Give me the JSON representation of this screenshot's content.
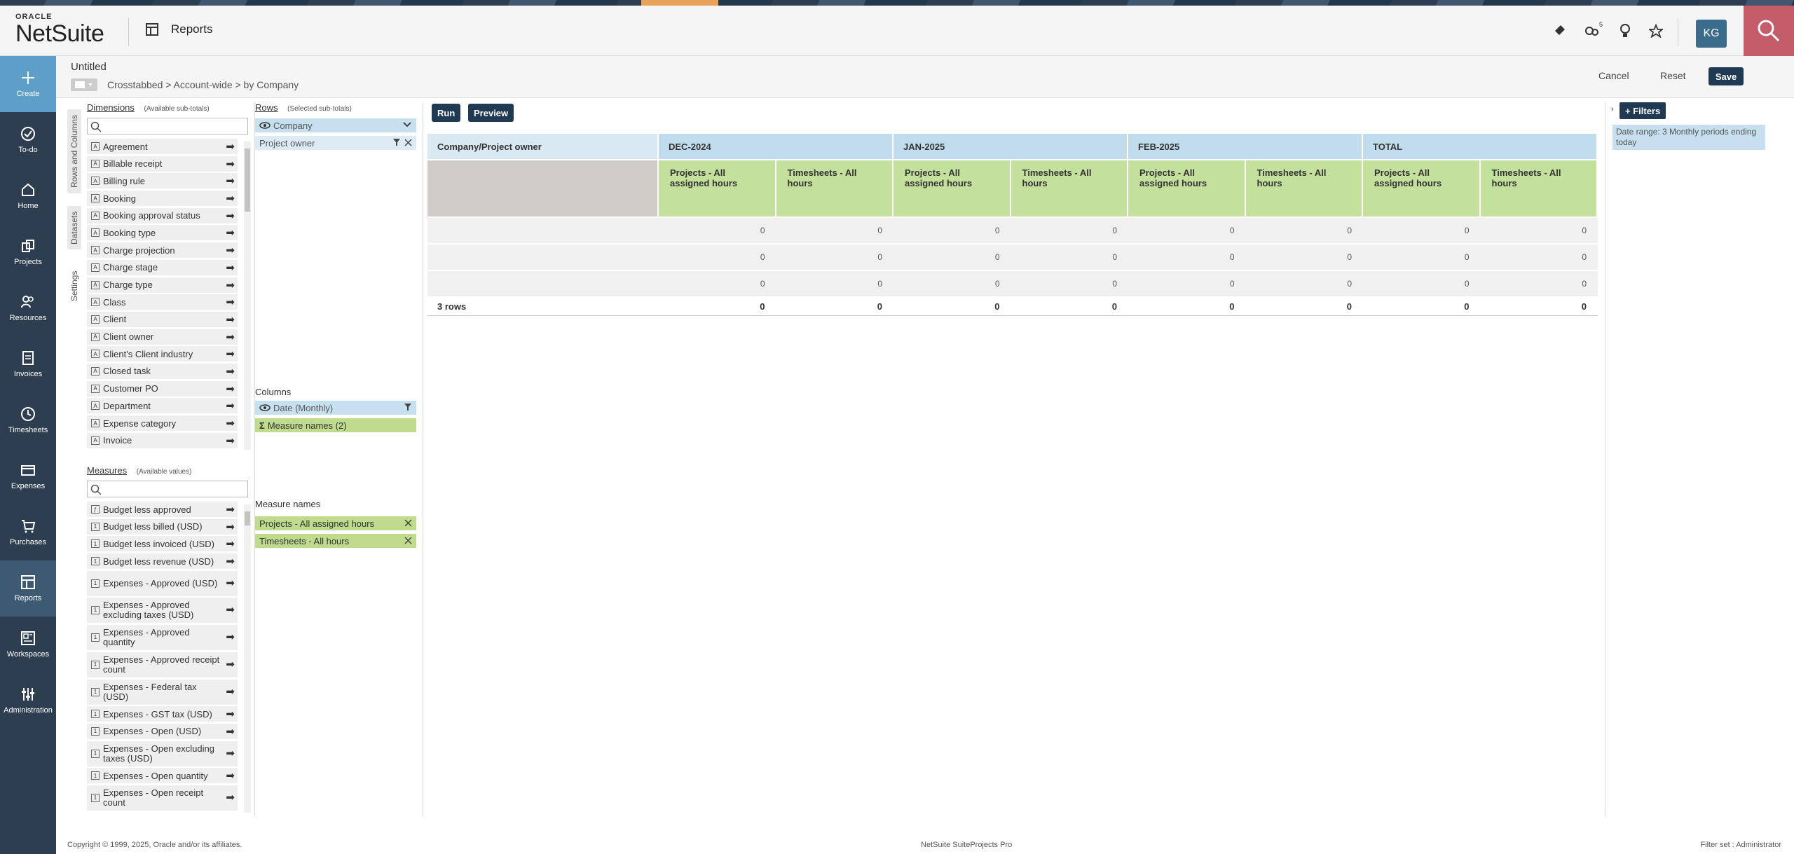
{
  "header": {
    "logo_top": "ORACLE",
    "logo_main": "NetSuite",
    "section_title": "Reports",
    "avatar_initials": "KG",
    "notification_count": "5",
    "search_color": "#c45c6a"
  },
  "nav": {
    "items": [
      {
        "label": "Create",
        "icon": "plus-icon"
      },
      {
        "label": "To-do",
        "icon": "check-circle-icon"
      },
      {
        "label": "Home",
        "icon": "home-icon"
      },
      {
        "label": "Projects",
        "icon": "projects-icon"
      },
      {
        "label": "Resources",
        "icon": "people-icon"
      },
      {
        "label": "Invoices",
        "icon": "invoice-icon"
      },
      {
        "label": "Timesheets",
        "icon": "clock-icon"
      },
      {
        "label": "Expenses",
        "icon": "card-icon"
      },
      {
        "label": "Purchases",
        "icon": "cart-icon"
      },
      {
        "label": "Reports",
        "icon": "reports-icon"
      },
      {
        "label": "Workspaces",
        "icon": "workspaces-icon"
      },
      {
        "label": "Administration",
        "icon": "sliders-icon"
      }
    ]
  },
  "subheader": {
    "title": "Untitled",
    "breadcrumb": "Crosstabbed > Account-wide > by Company",
    "cancel": "Cancel",
    "reset": "Reset",
    "save": "Save"
  },
  "tabs": {
    "rows_columns": "Rows and Columns",
    "datasets": "Datasets",
    "settings": "Settings"
  },
  "dimensions": {
    "title": "Dimensions",
    "subtitle": "(Available sub-totals)",
    "items": [
      "Agreement",
      "Billable receipt",
      "Billing rule",
      "Booking",
      "Booking approval status",
      "Booking type",
      "Charge projection",
      "Charge stage",
      "Charge type",
      "Class",
      "Client",
      "Client owner",
      "Client's Client industry",
      "Closed task",
      "Customer PO",
      "Department",
      "Expense category",
      "Invoice"
    ]
  },
  "measures": {
    "title": "Measures",
    "subtitle": "(Available values)",
    "items": [
      {
        "label": "Budget less approved",
        "tall": false
      },
      {
        "label": "Budget less billed (USD)",
        "tall": false
      },
      {
        "label": "Budget less invoiced (USD)",
        "tall": false
      },
      {
        "label": "Budget less revenue (USD)",
        "tall": false
      },
      {
        "label": "Expenses - Approved (USD)",
        "tall": true
      },
      {
        "label": "Expenses - Approved excluding taxes (USD)",
        "tall": true
      },
      {
        "label": "Expenses - Approved quantity",
        "tall": true
      },
      {
        "label": "Expenses - Approved receipt count",
        "tall": true
      },
      {
        "label": "Expenses - Federal tax (USD)",
        "tall": true
      },
      {
        "label": "Expenses - GST tax (USD)",
        "tall": false
      },
      {
        "label": "Expenses - Open (USD)",
        "tall": false
      },
      {
        "label": "Expenses - Open excluding taxes (USD)",
        "tall": true
      },
      {
        "label": "Expenses - Open quantity",
        "tall": false
      },
      {
        "label": "Expenses - Open receipt count",
        "tall": true
      }
    ]
  },
  "rows_panel": {
    "title": "Rows",
    "subtitle": "(Selected sub-totals)",
    "chips": [
      "Company",
      "Project owner"
    ]
  },
  "columns_panel": {
    "title": "Columns",
    "chips": [
      "Date (Monthly)",
      "Measure names (2)"
    ]
  },
  "measure_names_panel": {
    "title": "Measure names",
    "chips": [
      "Projects - All assigned hours",
      "Timesheets - All hours"
    ]
  },
  "report": {
    "run": "Run",
    "preview": "Preview",
    "row_header": "Company/Project owner",
    "periods": [
      "DEC-2024",
      "JAN-2025",
      "FEB-2025",
      "TOTAL"
    ],
    "measure_headers": [
      "Projects - All assigned hours",
      "Timesheets - All hours"
    ],
    "rows": [
      [
        "",
        "0",
        "0",
        "0",
        "0",
        "0",
        "0",
        "0",
        "0"
      ],
      [
        "",
        "0",
        "0",
        "0",
        "0",
        "0",
        "0",
        "0",
        "0"
      ],
      [
        "",
        "0",
        "0",
        "0",
        "0",
        "0",
        "0",
        "0",
        "0"
      ]
    ],
    "total_row": [
      "3 rows",
      "0",
      "0",
      "0",
      "0",
      "0",
      "0",
      "0",
      "0"
    ]
  },
  "filters": {
    "add": "+ Filters",
    "chip": "Date range: 3 Monthly periods ending today"
  },
  "footer": {
    "copyright": "Copyright © 1999, 2025, Oracle and/or its affiliates.",
    "product": "NetSuite SuiteProjects Pro",
    "filter_set": "Filter set : Administrator"
  }
}
